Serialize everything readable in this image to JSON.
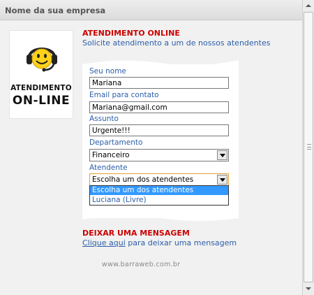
{
  "header": {
    "title": "Nome da sua empresa"
  },
  "logo": {
    "line1": "ATENDIMENTO",
    "line2": "ON-LINE"
  },
  "online": {
    "title": "ATENDIMENTO ONLINE",
    "subtitle": "Solicite atendimento a um de nossos atendentes"
  },
  "form": {
    "name_label": "Seu nome",
    "name_value": "Mariana",
    "email_label": "Email para contato",
    "email_value": "Mariana@gmail.com",
    "subject_label": "Assunto",
    "subject_value": "Urgente!!!",
    "department_label": "Departamento",
    "department_value": "Financeiro",
    "attendant_label": "Atendente",
    "attendant_value": "Escolha um dos atendentes",
    "attendant_options": [
      "Escolha um dos atendentes",
      "Luciana (Livre)"
    ]
  },
  "message": {
    "title": "DEIXAR UMA MENSAGEM",
    "link_text": "Clique aqui",
    "rest_text": " para deixar uma mensagem"
  },
  "footer": {
    "text": "www.barraweb.com.br"
  },
  "colors": {
    "accent_red": "#cc0000",
    "link_blue": "#2b5ea8",
    "selection_blue": "#3399ff"
  }
}
